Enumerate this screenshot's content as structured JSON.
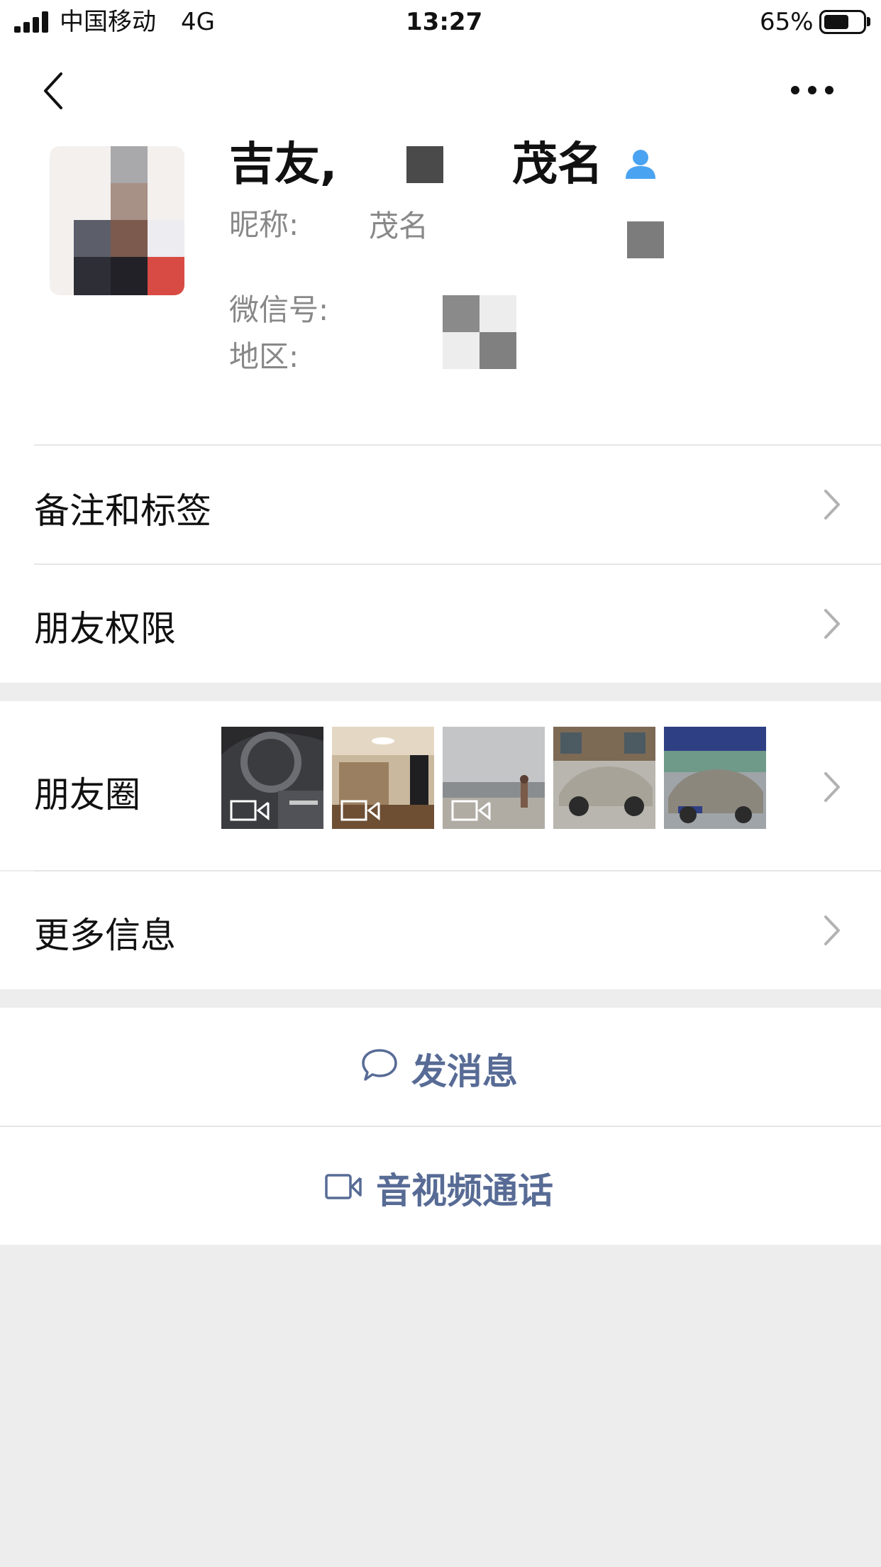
{
  "status_bar": {
    "carrier": "中国移动",
    "network": "4G",
    "time": "13:27",
    "battery_percent_text": "65%",
    "battery_level": 0.65
  },
  "nav": {
    "back_icon": "chevron-left-icon",
    "more_icon": "ellipsis-icon"
  },
  "profile": {
    "name_prefix": "吉友,",
    "name_suffix": "茂名",
    "contact_icon": "person-icon",
    "nickname_label": "昵称:",
    "nickname_value": "茂名",
    "wechat_id_label": "微信号:",
    "region_label": "地区:"
  },
  "rows": {
    "remarks": "备注和标签",
    "permissions": "朋友权限",
    "moments": "朋友圈",
    "more_info": "更多信息"
  },
  "moments_thumbs": [
    {
      "kind": "car-interior",
      "video": true
    },
    {
      "kind": "room",
      "video": true
    },
    {
      "kind": "beach",
      "video": true
    },
    {
      "kind": "car-silver",
      "video": false
    },
    {
      "kind": "car-dealer",
      "video": false
    }
  ],
  "actions": {
    "message": "发消息",
    "message_icon": "chat-bubble-icon",
    "call": "音视频通话",
    "call_icon": "video-camera-icon"
  },
  "colors": {
    "accent_link": "#576b95",
    "contact_icon": "#4aa3f0",
    "background": "#ededed"
  }
}
